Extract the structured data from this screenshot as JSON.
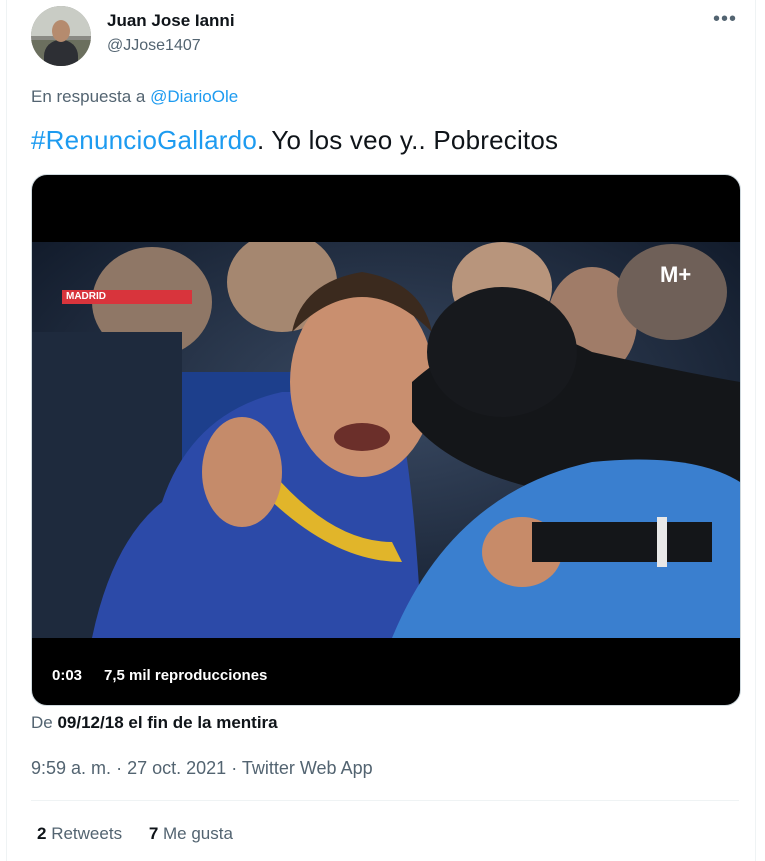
{
  "author": {
    "name": "Juan Jose Ianni",
    "handle": "@JJose1407"
  },
  "more_label": "•••",
  "reply": {
    "prefix": "En respuesta a",
    "mention": "@DiarioOle"
  },
  "tweet": {
    "hashtag": "#RenuncioGallardo",
    "text": ". Yo los veo y.. Pobrecitos"
  },
  "video": {
    "channel_label": "MADRID",
    "broadcaster": "M+",
    "time": "0:03",
    "views": "7,5 mil reproducciones"
  },
  "source": {
    "prefix": "De",
    "title": "09/12/18 el fin de la mentira"
  },
  "meta": {
    "time": "9:59 a. m.",
    "date": "27 oct. 2021",
    "client": "Twitter Web App",
    "separator": "·"
  },
  "stats": {
    "retweets_count": "2",
    "retweets_label": "Retweets",
    "likes_count": "7",
    "likes_label": "Me gusta"
  },
  "colors": {
    "link": "#1d9bf0",
    "muted": "#536471",
    "text": "#0f1419",
    "border": "#cfd9de"
  }
}
